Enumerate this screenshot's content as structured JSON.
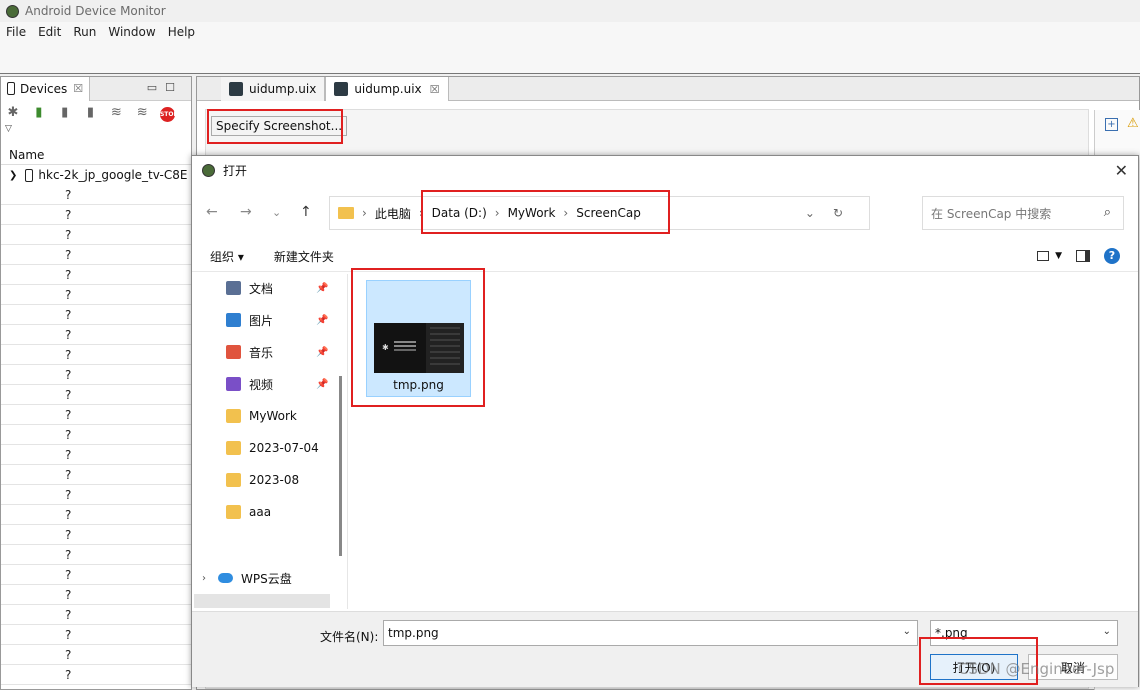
{
  "window": {
    "title": "Android Device Monitor"
  },
  "menu": [
    "File",
    "Edit",
    "Run",
    "Window",
    "Help"
  ],
  "devices_panel": {
    "tab_label": "Devices",
    "tab_close": "☒",
    "column_name": "Name",
    "device_name": "hkc-2k_jp_google_tv-C8E",
    "rows": [
      "?",
      "?",
      "?",
      "?",
      "?",
      "?",
      "?",
      "?",
      "?",
      "?",
      "?",
      "?",
      "?",
      "?",
      "?",
      "?",
      "?",
      "?",
      "?",
      "?",
      "?",
      "?",
      "?",
      "?",
      "?"
    ]
  },
  "editor": {
    "tabs": [
      {
        "label": "uidump.uix",
        "active": false
      },
      {
        "label": "uidump.uix",
        "active": true,
        "close": "☒"
      }
    ],
    "specify_button": "Specify Screenshot..."
  },
  "dialog": {
    "title": "打开",
    "breadcrumb": [
      "此电脑",
      "Data (D:)",
      "MyWork",
      "ScreenCap"
    ],
    "search_placeholder": "在 ScreenCap 中搜索",
    "commands": {
      "organize": "组织 ▾",
      "new_folder": "新建文件夹"
    },
    "nav_items": [
      {
        "label": "文档",
        "pinned": true,
        "color": "#5a6f94"
      },
      {
        "label": "图片",
        "pinned": true,
        "color": "#2f7fd0"
      },
      {
        "label": "音乐",
        "pinned": true,
        "color": "#e0543e"
      },
      {
        "label": "视频",
        "pinned": true,
        "color": "#7a4fc7"
      },
      {
        "label": "MyWork",
        "pinned": false,
        "color": "#f2c14e"
      },
      {
        "label": "2023-07-04",
        "pinned": false,
        "color": "#f2c14e"
      },
      {
        "label": "2023-08",
        "pinned": false,
        "color": "#f2c14e"
      },
      {
        "label": "aaa",
        "pinned": false,
        "color": "#f2c14e"
      }
    ],
    "wps_label": "WPS云盘",
    "file": {
      "name": "tmp.png"
    },
    "filename_label": "文件名(N):",
    "filename_value": "tmp.png",
    "filetype_value": "*.png",
    "open_button": "打开(O)",
    "cancel_button": "取消"
  },
  "watermark": "CSDN @Engineer-Jsp"
}
